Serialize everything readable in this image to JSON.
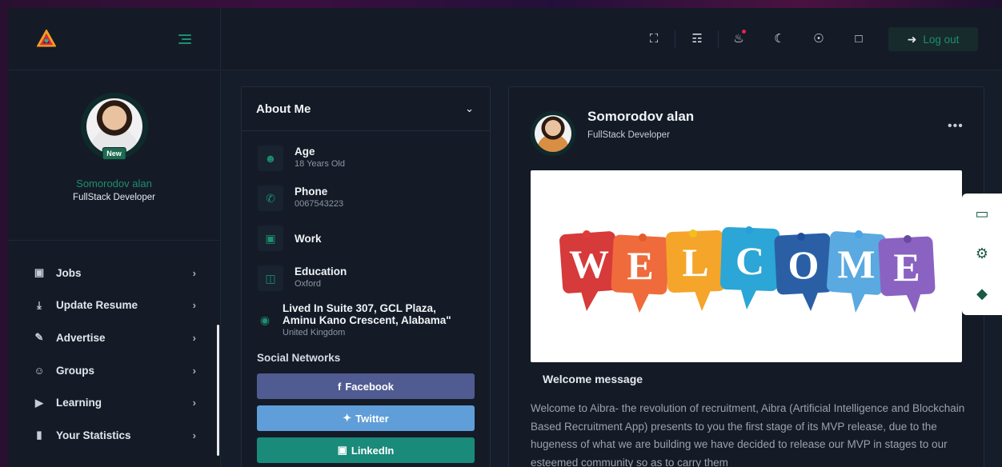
{
  "sidebar": {
    "profile": {
      "badge": "New",
      "name": "Somorodov alan",
      "role": "FullStack Developer"
    },
    "items": [
      {
        "icon": "briefcase-icon",
        "label": "Jobs"
      },
      {
        "icon": "download-icon",
        "label": "Update Resume"
      },
      {
        "icon": "edit-icon",
        "label": "Advertise"
      },
      {
        "icon": "users-icon",
        "label": "Groups"
      },
      {
        "icon": "video-icon",
        "label": "Learning"
      },
      {
        "icon": "bar-chart-icon",
        "label": "Your Statistics"
      }
    ]
  },
  "header": {
    "logout_label": "Log out"
  },
  "about": {
    "title": "About Me",
    "age_label": "Age",
    "age_value": "18 Years Old",
    "phone_label": "Phone",
    "phone_value": "0067543223",
    "work_label": "Work",
    "education_label": "Education",
    "education_value": "Oxford",
    "location_line1": "Lived In Suite 307, GCL Plaza,",
    "location_line2": "Aminu Kano Crescent, Alabama\"",
    "location_country": "United Kingdom",
    "social_title": "Social Networks",
    "facebook": "Facebook",
    "twitter": "Twitter",
    "linkedin": "LinkedIn"
  },
  "post": {
    "name": "Somorodov alan",
    "role": "FullStack Developer",
    "welcome_letters": [
      "W",
      "E",
      "L",
      "C",
      "O",
      "M",
      "E"
    ],
    "message_title": "Welcome message",
    "message_body": "Welcome to Aibra- the revolution of recruitment, Aibra (Artificial Intelligence and Blockchain Based Recruitment App) presents to you the first stage of its MVP release, due to the hugeness of what we are building we have decided to release our MVP in stages to our esteemed community so as to carry them"
  },
  "colors": {
    "accent": "#1e8f6e",
    "facebook": "#505b91",
    "twitter": "#5f9ed8",
    "linkedin": "#1a8a7a",
    "notification": "#e0264a"
  }
}
